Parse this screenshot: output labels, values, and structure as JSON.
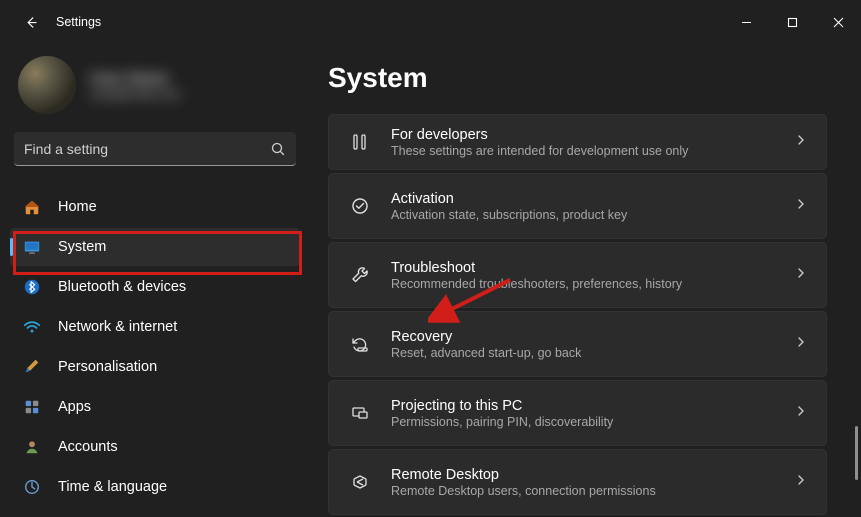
{
  "window": {
    "title": "Settings"
  },
  "profile": {
    "name_line1": "User Name",
    "name_line2": "user@email.com"
  },
  "search": {
    "placeholder": "Find a setting"
  },
  "sidebar": {
    "items": [
      {
        "label": "Home"
      },
      {
        "label": "System"
      },
      {
        "label": "Bluetooth & devices"
      },
      {
        "label": "Network & internet"
      },
      {
        "label": "Personalisation"
      },
      {
        "label": "Apps"
      },
      {
        "label": "Accounts"
      },
      {
        "label": "Time & language"
      }
    ]
  },
  "page": {
    "title": "System"
  },
  "settings": [
    {
      "title": "For developers",
      "desc": "These settings are intended for development use only"
    },
    {
      "title": "Activation",
      "desc": "Activation state, subscriptions, product key"
    },
    {
      "title": "Troubleshoot",
      "desc": "Recommended troubleshooters, preferences, history"
    },
    {
      "title": "Recovery",
      "desc": "Reset, advanced start-up, go back"
    },
    {
      "title": "Projecting to this PC",
      "desc": "Permissions, pairing PIN, discoverability"
    },
    {
      "title": "Remote Desktop",
      "desc": "Remote Desktop users, connection permissions"
    }
  ],
  "annotations": {
    "highlight_nav_index": 1,
    "arrow_target_index": 3
  }
}
